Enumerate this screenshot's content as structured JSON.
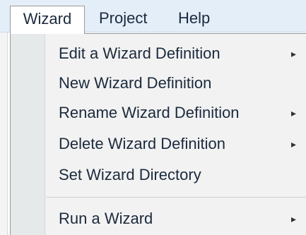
{
  "menubar": {
    "items": [
      {
        "label": "Wizard"
      },
      {
        "label": "Project"
      },
      {
        "label": "Help"
      }
    ]
  },
  "dropdown": {
    "items": [
      {
        "label": "Edit a Wizard Definition",
        "submenu_icon": "triangle-right"
      },
      {
        "label": "New Wizard Definition"
      },
      {
        "label": "Rename Wizard Definition",
        "submenu_icon": "triangle-right"
      },
      {
        "label": "Delete Wizard Definition",
        "submenu_icon": "triangle-right"
      },
      {
        "label": "Set Wizard Directory"
      },
      {
        "label": "Run a Wizard",
        "submenu_icon": "triangle-right"
      }
    ],
    "arrow_glyph": "▸"
  },
  "colors": {
    "menubar_bg": "#e3eef9",
    "dropdown_bg": "#f2f2f2",
    "icon_column_bg": "#e6e9ea",
    "text": "#1b2a3d"
  }
}
